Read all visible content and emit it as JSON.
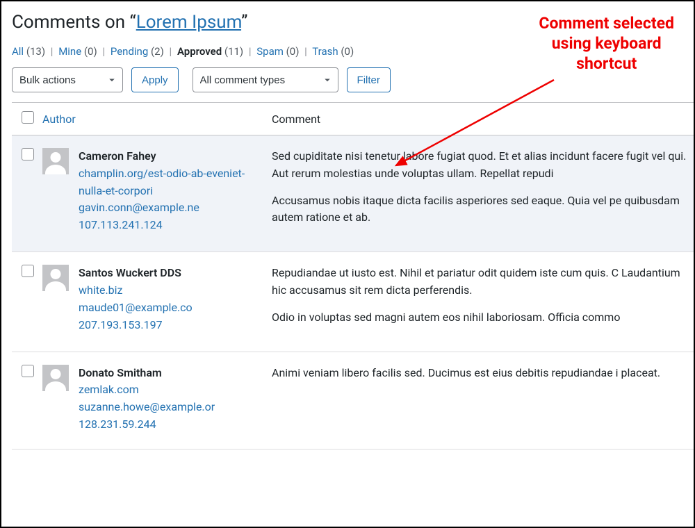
{
  "heading": {
    "prefix": "Comments on ",
    "ql": "“",
    "qr": "”",
    "title": "Lorem Ipsum"
  },
  "filters": {
    "all": {
      "label": "All",
      "count": "(13)"
    },
    "mine": {
      "label": "Mine",
      "count": "(0)"
    },
    "pending": {
      "label": "Pending",
      "count": "(2)"
    },
    "approved": {
      "label": "Approved",
      "count": "(11)"
    },
    "spam": {
      "label": "Spam",
      "count": "(0)"
    },
    "trash": {
      "label": "Trash",
      "count": "(0)"
    }
  },
  "controls": {
    "bulk": "Bulk actions",
    "apply": "Apply",
    "types": "All comment types",
    "filter": "Filter"
  },
  "columns": {
    "author": "Author",
    "comment": "Comment"
  },
  "rows": [
    {
      "name": "Cameron Fahey",
      "url": "champlin.org/est-odio-ab-eveniet-nulla-et-corpori",
      "email": "gavin.conn@example.ne",
      "ip": "107.113.241.124",
      "p1": "Sed cupiditate nisi tenetur labore fugiat quod. Et et alias incidunt facere fugit vel qui. Aut rerum molestias unde voluptas ullam. Repellat repudi",
      "p2": "Accusamus nobis itaque dicta facilis asperiores sed eaque. Quia vel pe quibusdam autem ratione et ab."
    },
    {
      "name": "Santos Wuckert DDS",
      "url": "white.biz",
      "email": "maude01@example.co",
      "ip": "207.193.153.197",
      "p1": "Repudiandae ut iusto est. Nihil et pariatur odit quidem iste cum quis. C Laudantium hic accusamus sit rem dicta perferendis.",
      "p2": "Odio in voluptas sed magni autem eos nihil laboriosam. Officia commo"
    },
    {
      "name": "Donato Smitham",
      "url": "zemlak.com",
      "email": "suzanne.howe@example.or",
      "ip": "128.231.59.244",
      "p1": "Animi veniam libero facilis sed. Ducimus est eius debitis repudiandae i placeat.",
      "p2": ""
    }
  ],
  "annotation": {
    "l1": "Comment selected",
    "l2": "using keyboard",
    "l3": "shortcut"
  }
}
